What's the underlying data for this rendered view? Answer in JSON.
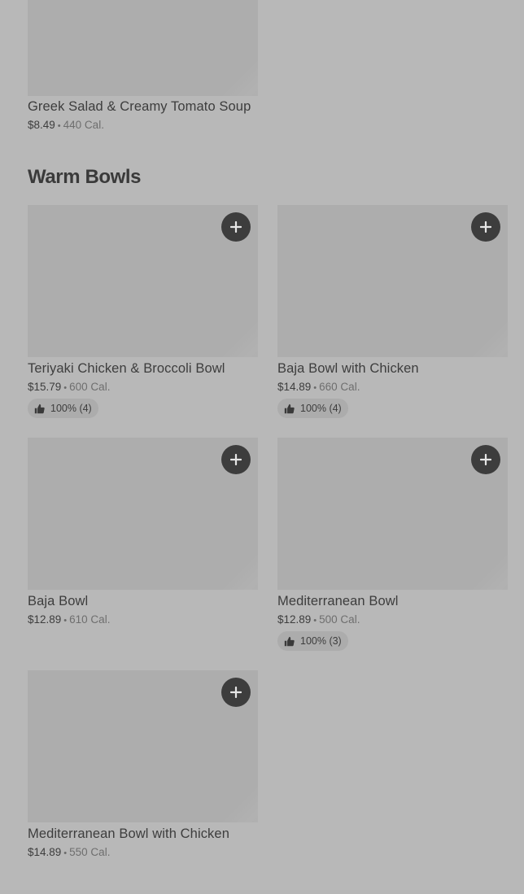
{
  "top_item": {
    "name": "Greek Salad & Creamy Tomato Soup",
    "price": "$8.49",
    "separator": "•",
    "calories": "440 Cal."
  },
  "section": {
    "title": "Warm Bowls"
  },
  "items": [
    {
      "name": "Teriyaki Chicken & Broccoli Bowl",
      "price": "$15.79",
      "separator": "•",
      "calories": "600 Cal.",
      "rating": "100% (4)",
      "add_icon": "plus-icon",
      "rating_icon": "thumbs-up-icon"
    },
    {
      "name": "Baja Bowl with Chicken",
      "price": "$14.89",
      "separator": "•",
      "calories": "660 Cal.",
      "rating": "100% (4)",
      "add_icon": "plus-icon",
      "rating_icon": "thumbs-up-icon"
    },
    {
      "name": "Baja Bowl",
      "price": "$12.89",
      "separator": "•",
      "calories": "610 Cal.",
      "add_icon": "plus-icon"
    },
    {
      "name": "Mediterranean Bowl",
      "price": "$12.89",
      "separator": "•",
      "calories": "500 Cal.",
      "rating": "100% (3)",
      "add_icon": "plus-icon",
      "rating_icon": "thumbs-up-icon"
    },
    {
      "name": "Mediterranean Bowl with Chicken",
      "price": "$14.89",
      "separator": "•",
      "calories": "550 Cal.",
      "add_icon": "plus-icon"
    }
  ],
  "colors": {
    "overlay_background": "#b8b8b8",
    "image_placeholder": "#adadad",
    "button": "#3d3d3d",
    "text_primary": "#3d3d3d",
    "text_secondary": "#6e6e6e"
  }
}
